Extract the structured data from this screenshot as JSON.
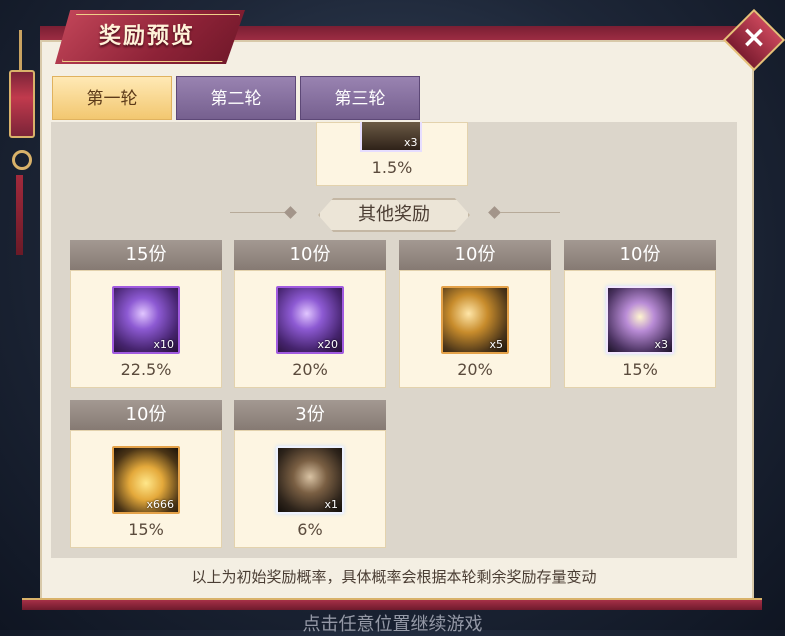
{
  "title": "奖励预览",
  "close_icon": "×",
  "tabs": [
    {
      "label": "第一轮",
      "active": true
    },
    {
      "label": "第二轮",
      "active": false
    },
    {
      "label": "第三轮",
      "active": false
    }
  ],
  "top_item": {
    "qty": "x3",
    "percent": "1.5%"
  },
  "section_title": "其他奖励",
  "rewards": [
    {
      "count": "15份",
      "qty": "x10",
      "percent": "22.5%",
      "icon": "purple-crystal-icon"
    },
    {
      "count": "10份",
      "qty": "x20",
      "percent": "20%",
      "icon": "purple-crystal-icon"
    },
    {
      "count": "10份",
      "qty": "x5",
      "percent": "20%",
      "icon": "gold-purple-crystal-icon"
    },
    {
      "count": "10份",
      "qty": "x3",
      "percent": "15%",
      "icon": "mixed-crystal-icon"
    },
    {
      "count": "10份",
      "qty": "x666",
      "percent": "15%",
      "icon": "gold-ingot-icon"
    },
    {
      "count": "3份",
      "qty": "x1",
      "percent": "6%",
      "icon": "hero-card-icon"
    }
  ],
  "footer_note": "以上为初始奖励概率，具体概率会根据本轮剩余奖励存量变动",
  "bottom_hint": "点击任意位置继续游戏"
}
